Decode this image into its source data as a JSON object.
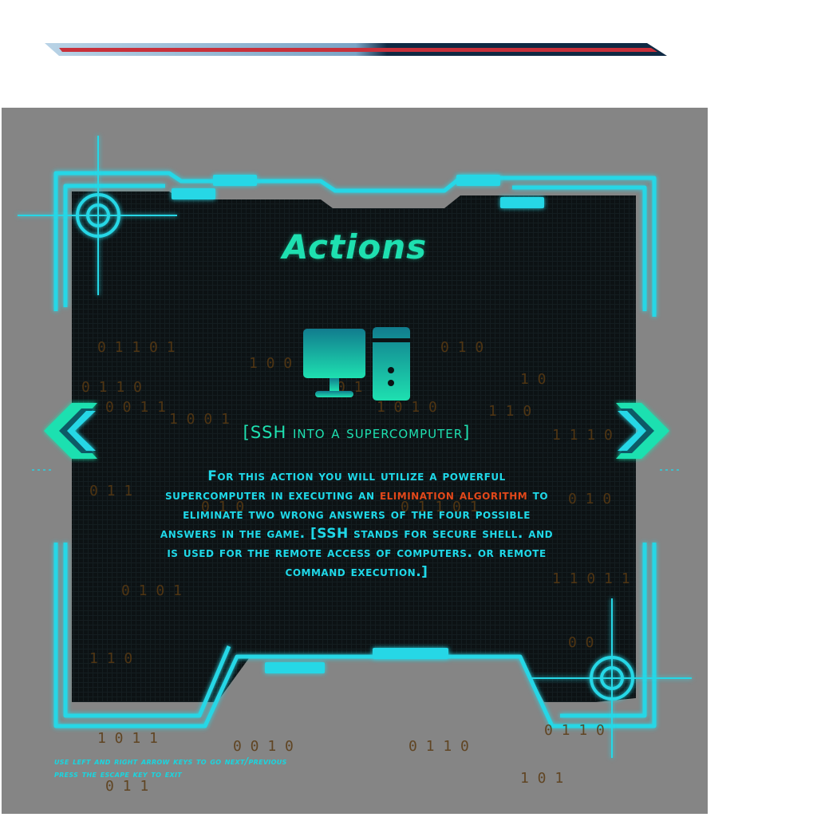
{
  "screen": {
    "title": "Actions",
    "action_icon": "desktop-computer-icon",
    "action_name": "[SSH into a supercomputer]",
    "description": {
      "part1": "For this action you will utilize a powerful supercomputer in executing an ",
      "highlight": "elimination algorithm",
      "part2": " to eliminate two wrong answers of the four possible answers in the game. [SSH stands for secure shell. and is used for the remote access of computers. or remote command execution.]"
    },
    "nav": {
      "previous_icon": "chevron-double-left-icon",
      "next_icon": "chevron-double-right-icon"
    }
  },
  "hints": {
    "line1": "use left and right arrow keys to go next/previous",
    "line2": "press the escape key to exit"
  },
  "colors": {
    "accent_cyan": "#1fd8e8",
    "accent_green": "#1ee0b0",
    "highlight_orange": "#e2481a",
    "panel_dark": "#0d1417",
    "backdrop_gray": "#858585"
  }
}
